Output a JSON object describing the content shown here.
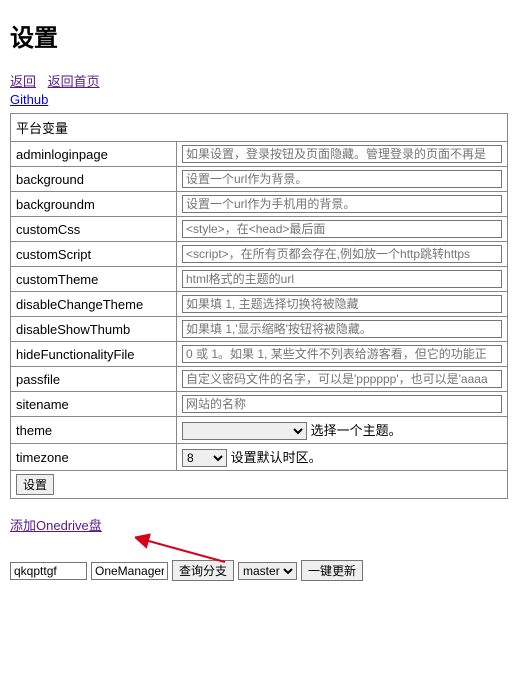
{
  "title": "设置",
  "nav": {
    "back": "返回",
    "home": "返回首页",
    "github": "Github"
  },
  "table": {
    "header": "平台变量",
    "rows": [
      {
        "key": "adminloginpage",
        "placeholder": "如果设置，登录按钮及页面隐藏。管理登录的页面不再是",
        "value": ""
      },
      {
        "key": "background",
        "placeholder": "设置一个url作为背景。",
        "value": ""
      },
      {
        "key": "backgroundm",
        "placeholder": "设置一个url作为手机用的背景。",
        "value": ""
      },
      {
        "key": "customCss",
        "placeholder": "<style>，在<head>最后面",
        "value": ""
      },
      {
        "key": "customScript",
        "placeholder": "<script>，在所有页都会存在,例如放一个http跳转https",
        "value": ""
      },
      {
        "key": "customTheme",
        "placeholder": "html格式的主题的url",
        "value": ""
      },
      {
        "key": "disableChangeTheme",
        "placeholder": "如果填 1, 主题选择切换将被隐藏",
        "value": ""
      },
      {
        "key": "disableShowThumb",
        "placeholder": "如果填 1,'显示缩略'按钮将被隐藏。",
        "value": ""
      },
      {
        "key": "hideFunctionalityFile",
        "placeholder": "0 或 1。如果 1, 某些文件不列表给游客看，但它的功能正",
        "value": ""
      },
      {
        "key": "passfile",
        "placeholder": "自定义密码文件的名字，可以是'pppppp'，也可以是'aaaa",
        "value": ""
      },
      {
        "key": "sitename",
        "placeholder": "网站的名称",
        "value": ""
      }
    ],
    "theme": {
      "key": "theme",
      "selected": "",
      "desc": "选择一个主题。"
    },
    "timezone": {
      "key": "timezone",
      "selected": "8",
      "desc": "设置默认时区。"
    },
    "submit": "设置"
  },
  "add_onedrive": "添加Onedrive盘",
  "bottom": {
    "repo_value": "qkqpttgf",
    "owner_value": "OneManager-php",
    "query_branch": "查询分支",
    "branch_selected": "master",
    "update": "一键更新"
  }
}
